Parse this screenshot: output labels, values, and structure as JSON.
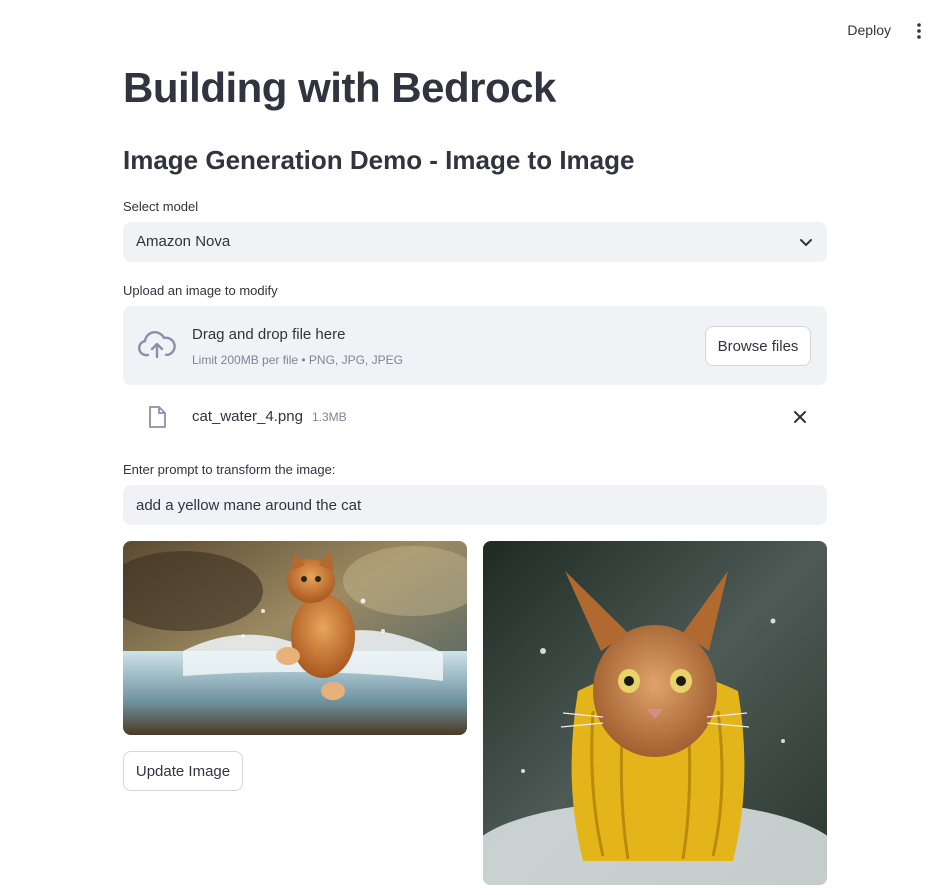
{
  "header": {
    "deploy_label": "Deploy",
    "menu_icon": "vertical-dots-icon"
  },
  "page": {
    "title": "Building with Bedrock",
    "subtitle": "Image Generation Demo - Image to Image"
  },
  "model_select": {
    "label": "Select model",
    "value": "Amazon Nova",
    "icon": "chevron-down-icon"
  },
  "uploader": {
    "label": "Upload an image to modify",
    "title": "Drag and drop file here",
    "limits": "Limit 200MB per file • PNG, JPG, JPEG",
    "browse_label": "Browse files",
    "icon": "cloud-upload-icon"
  },
  "uploaded_file": {
    "name": "cat_water_4.png",
    "size": "1.3MB",
    "icon": "file-icon",
    "remove_icon": "close-icon"
  },
  "prompt": {
    "label": "Enter prompt to transform the image:",
    "value": "add a yellow mane around the cat"
  },
  "actions": {
    "update_label": "Update Image"
  },
  "colors": {
    "text": "#31333f",
    "input_bg": "#f0f2f6",
    "muted": "#808495",
    "border": "#d6d6d9"
  }
}
